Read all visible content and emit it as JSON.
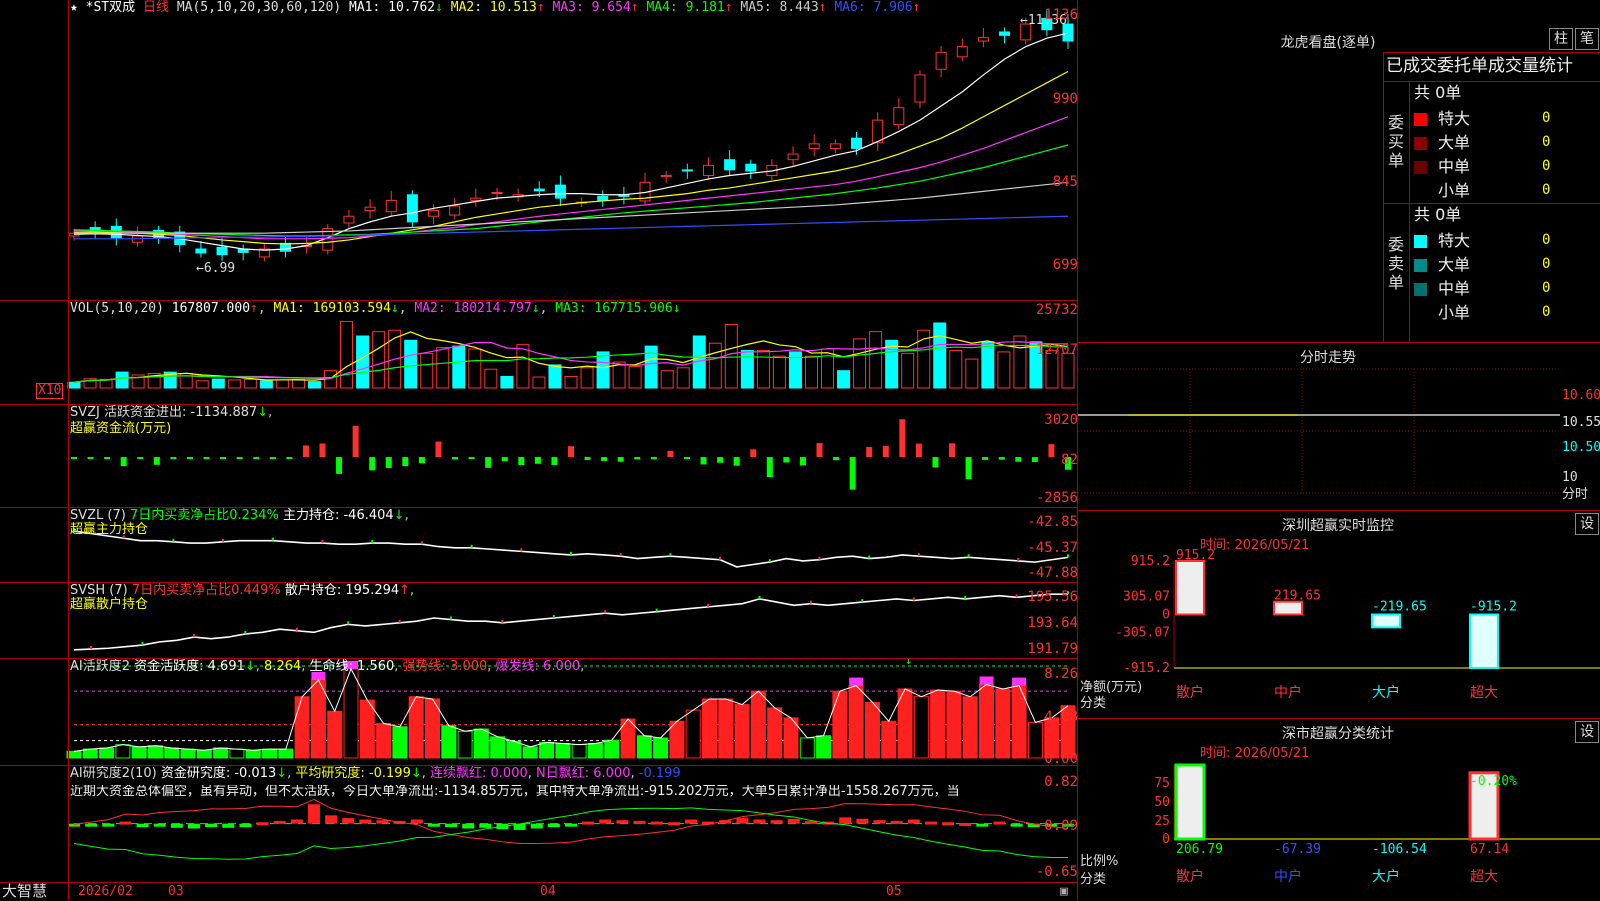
{
  "header": {
    "stock_name": "*ST双成",
    "period": "日线",
    "ma_label": "MA(5,10,20,30,60,120)",
    "ma": [
      {
        "label": "MA1: 10.762",
        "arrow": "↓",
        "color": "#ffffff"
      },
      {
        "label": "MA2: 10.513",
        "arrow": "↑",
        "color": "#ffff00"
      },
      {
        "label": "MA3: 9.654",
        "arrow": "↑",
        "color": "#ff33ff"
      },
      {
        "label": "MA4: 9.181",
        "arrow": "↑",
        "color": "#00ff00"
      },
      {
        "label": "MA5: 8.443",
        "arrow": "↑",
        "color": "#cccccc"
      },
      {
        "label": "MA6: 7.906",
        "arrow": "↑",
        "color": "#3050ff"
      }
    ],
    "hi_mark": "11.36",
    "lo_mark": "6.99"
  },
  "price_axis": [
    "1136",
    "990",
    "845",
    "699"
  ],
  "vol": {
    "label": "VOL(5,10,20)",
    "value": "167807.000",
    "ma1": "MA1: 169103.594",
    "ma2": "MA2: 180214.797",
    "ma3": "MA3: 167715.906",
    "axis": [
      "25732",
      "12707"
    ],
    "unit": "X10"
  },
  "svzj": {
    "label": "SVZJ",
    "text": "活跃资金进出: -1134.887",
    "sub": "超赢资金流(万元)",
    "axis": [
      "3020",
      "82",
      "-2856"
    ]
  },
  "svzl": {
    "label": "SVZL (7)",
    "text1": "7日内买卖净占比0.234%",
    "text2": "主力持仓: -46.404",
    "sub": "超赢主力持仓",
    "axis": [
      "-42.85",
      "-45.37",
      "-47.88"
    ]
  },
  "svsh": {
    "label": "SVSH (7)",
    "text1": "7日内买卖净占比0.449%",
    "text2": "散户持仓: 195.294",
    "sub": "超赢散户持仓",
    "axis": [
      "195.56",
      "193.64",
      "191.79"
    ]
  },
  "ai1": {
    "label": "AI活跃度2",
    "t1": "资金活跃度: 4.691",
    "t2": "8.264",
    "t3": "生命线: 1.560",
    "t4": "强势线: 3.000",
    "t5": "爆发线: 6.000",
    "axis": [
      "8.26",
      "4.08",
      "0.00"
    ]
  },
  "ai2": {
    "label": "AI研究度2(10)",
    "t1": "资金研究度: -0.013",
    "t2": "平均研究度: -0.199",
    "t3": "连续飘红: 0.000",
    "t4": "N日飘红: 6.000",
    "t5": "-0.199",
    "desc": "近期大资金总体偏空，虽有异动，但不太活跃，今日大单净流出:-1134.85万元，其中特大单净流出:-915.202万元，大单5日累计净出-1558.267万元，当",
    "axis": [
      "0.82",
      "0.09",
      "-0.65"
    ]
  },
  "bottom_axis": {
    "brand": "大智慧",
    "labels": [
      "2026/02",
      "03",
      "04",
      "05"
    ]
  },
  "lhk": {
    "title": "龙虎看盘(逐单)",
    "btn1": "柱",
    "btn2": "笔",
    "subtitle": "已成交委托单成交量统计",
    "buy": {
      "side": "委买单",
      "total": "共 0单",
      "rows": [
        {
          "name": "特大",
          "value": "0",
          "color": "#ff0000"
        },
        {
          "name": "大单",
          "value": "0",
          "color": "#8b0000"
        },
        {
          "name": "中单",
          "value": "0",
          "color": "#6b0000"
        },
        {
          "name": "小单",
          "value": "0",
          "color": "#000000"
        }
      ]
    },
    "sell": {
      "side": "委卖单",
      "total": "共 0单",
      "rows": [
        {
          "name": "特大",
          "value": "0",
          "color": "#00ffff"
        },
        {
          "name": "大单",
          "value": "0",
          "color": "#008b8b"
        },
        {
          "name": "中单",
          "value": "0",
          "color": "#007070"
        },
        {
          "name": "小单",
          "value": "0",
          "color": "#000000"
        }
      ]
    }
  },
  "fenshi": {
    "title": "分时走势",
    "axis": [
      "10.60",
      "10.55",
      "10.50",
      "10"
    ],
    "unit": "分时"
  },
  "szcy": {
    "title": "深圳超赢实时监控",
    "btn": "设",
    "time": "时间: 2026/05/21",
    "axis": [
      "915.2",
      "305.07",
      "0",
      "-305.07",
      "-915.2"
    ],
    "ylabel": "净额(万元)",
    "xlabel": "分类",
    "cats": [
      "散户",
      "中户",
      "大户",
      "超大"
    ],
    "values": [
      915.2,
      219.65,
      -219.65,
      -915.2
    ],
    "value_labels": [
      "915.2",
      "219.65",
      "-219.65",
      "-915.2"
    ]
  },
  "sscy": {
    "title": "深市超赢分类统计",
    "btn": "设",
    "time": "时间: 2026/05/21",
    "axis": [
      "75",
      "50",
      "25",
      "0"
    ],
    "ylabel": "比例%",
    "xlabel": "分类",
    "cats": [
      "散户",
      "中户",
      "大户",
      "超大"
    ],
    "bottom_values": [
      "206.79",
      "-67.39",
      "-106.54",
      "67.14"
    ],
    "top_label": "-0.20%"
  },
  "chart_data": [
    {
      "type": "candlestick",
      "title": "*ST双成 日线",
      "ylim": [
        699,
        1136
      ],
      "x": [
        "2026/02",
        "03",
        "04",
        "05"
      ],
      "series": [
        {
          "name": "close",
          "values": [
            750,
            752,
            742,
            745,
            742,
            730,
            715,
            712,
            716,
            722,
            718,
            728,
            758,
            780,
            796,
            808,
            770,
            790,
            798,
            812,
            822,
            818,
            825,
            812,
            805,
            808,
            815,
            840,
            852,
            860,
            870,
            862,
            860,
            870,
            890,
            908,
            908,
            900,
            950,
            972,
            1030,
            1070,
            1080,
            1096,
            1100,
            1120,
            1110,
            1090
          ]
        },
        {
          "name": "MA1",
          "values": [
            748,
            749,
            748,
            746,
            744,
            740,
            734,
            728,
            722,
            720,
            722,
            728,
            742,
            758,
            770,
            780,
            786,
            794,
            800,
            806,
            812,
            815,
            818,
            820,
            820,
            818,
            818,
            822,
            830,
            838,
            846,
            852,
            856,
            860,
            868,
            878,
            888,
            896,
            912,
            930,
            950,
            975,
            1000,
            1030,
            1058,
            1080,
            1095,
            1104
          ]
        },
        {
          "name": "MA2",
          "values": [
            752,
            752,
            751,
            750,
            748,
            746,
            742,
            738,
            735,
            732,
            731,
            732,
            734,
            738,
            744,
            750,
            756,
            762,
            770,
            778,
            784,
            790,
            796,
            800,
            804,
            807,
            810,
            812,
            816,
            820,
            826,
            830,
            836,
            842,
            848,
            854,
            860,
            868,
            878,
            890,
            904,
            918,
            936,
            956,
            976,
            996,
            1016,
            1036
          ]
        },
        {
          "name": "MA3",
          "values": [
            755,
            754,
            753,
            752,
            750,
            748,
            746,
            744,
            742,
            740,
            740,
            740,
            741,
            742,
            745,
            748,
            752,
            756,
            760,
            765,
            770,
            775,
            780,
            784,
            788,
            792,
            796,
            800,
            804,
            808,
            812,
            816,
            820,
            824,
            828,
            832,
            836,
            842,
            850,
            858,
            866,
            876,
            888,
            900,
            914,
            928,
            942,
            956
          ]
        },
        {
          "name": "MA4",
          "values": [
            756,
            755,
            754,
            753,
            752,
            750,
            749,
            748,
            747,
            746,
            745,
            745,
            746,
            747,
            748,
            750,
            752,
            754,
            756,
            758,
            762,
            766,
            770,
            774,
            778,
            782,
            786,
            789,
            792,
            795,
            798,
            801,
            804,
            808,
            812,
            816,
            820,
            825,
            830,
            836,
            842,
            850,
            858,
            866,
            876,
            886,
            896,
            906
          ]
        },
        {
          "name": "MA5",
          "values": [
            750,
            750,
            750,
            750,
            750,
            750,
            750,
            750,
            750,
            750,
            751,
            752,
            753,
            754,
            756,
            758,
            760,
            762,
            764,
            766,
            768,
            770,
            772,
            774,
            776,
            778,
            780,
            782,
            784,
            786,
            788,
            790,
            792,
            794,
            796,
            798,
            800,
            803,
            806,
            809,
            812,
            816,
            820,
            824,
            828,
            832,
            836,
            840
          ]
        },
        {
          "name": "MA6",
          "values": [
            740,
            740,
            740,
            740,
            741,
            741,
            742,
            742,
            743,
            743,
            744,
            744,
            745,
            746,
            747,
            748,
            749,
            750,
            751,
            752,
            753,
            754,
            755,
            756,
            757,
            758,
            759,
            760,
            761,
            762,
            763,
            764,
            765,
            766,
            767,
            768,
            769,
            770,
            771,
            772,
            773,
            774,
            775,
            776,
            777,
            778,
            779,
            780
          ]
        }
      ]
    },
    {
      "type": "bar",
      "title": "VOL(5,10,20)",
      "ylim": [
        0,
        27000
      ],
      "series": [
        {
          "name": "VOL",
          "values": [
            2000,
            3200,
            3000,
            5500,
            4500,
            5000,
            5500,
            5000,
            2500,
            3100,
            2800,
            3000,
            2500,
            2800,
            3000,
            2200,
            6000,
            23000,
            18000,
            19500,
            20000,
            16500,
            12000,
            14000,
            14500,
            13500,
            6500,
            4000,
            15000,
            3800,
            8000,
            4000,
            7000,
            12500,
            9000,
            7500,
            14500,
            6000,
            7000,
            18000,
            15500,
            22000,
            13000,
            13000,
            11000,
            12500,
            11000,
            13500,
            6000,
            17000,
            19500,
            16500,
            12000,
            20000,
            22500,
            13000,
            10000,
            16000,
            12500,
            18000,
            16000,
            13000,
            12000
          ]
        }
      ]
    },
    {
      "type": "bar",
      "title": "SVZJ 超赢资金流(万元)",
      "ylim": [
        -2856,
        3020
      ],
      "series": [
        {
          "name": "SVZJ",
          "values": [
            -40,
            -60,
            -80,
            -700,
            -80,
            -600,
            -70,
            -60,
            -60,
            -90,
            -40,
            -30,
            -20,
            -10,
            900,
            1050,
            -1300,
            2420,
            -1030,
            -840,
            -700,
            -480,
            1200,
            -180,
            -90,
            -830,
            -320,
            -620,
            -520,
            -610,
            840,
            -220,
            -300,
            -360,
            -180,
            -170,
            480,
            -70,
            -570,
            -440,
            -660,
            600,
            -1550,
            -420,
            -640,
            1080,
            -240,
            -2520,
            780,
            860,
            2920,
            1040,
            -800,
            1060,
            -1710,
            -220,
            -200,
            -360,
            -380,
            1000,
            -980
          ]
        }
      ]
    },
    {
      "type": "line",
      "title": "SVZL 超赢主力持仓",
      "ylim": [
        -47.88,
        -42.85
      ],
      "series": [
        {
          "name": "主力持仓",
          "values": [
            -44.2,
            -44.4,
            -44.6,
            -44.8,
            -45.0,
            -45.0,
            -45.1,
            -45.2,
            -45.2,
            -45.1,
            -45.0,
            -45.0,
            -45.0,
            -45.1,
            -45.2,
            -45.2,
            -45.3,
            -45.3,
            -45.2,
            -45.2,
            -45.3,
            -45.3,
            -45.5,
            -45.6,
            -45.6,
            -45.7,
            -45.8,
            -45.9,
            -46.0,
            -46.1,
            -46.2,
            -46.1,
            -46.2,
            -46.3,
            -46.5,
            -46.4,
            -46.3,
            -46.4,
            -46.5,
            -46.6,
            -47.2,
            -47.0,
            -46.8,
            -46.5,
            -46.7,
            -46.6,
            -46.4,
            -46.3,
            -46.5,
            -46.4,
            -46.2,
            -46.3,
            -46.4,
            -46.5,
            -46.4,
            -46.5,
            -46.6,
            -46.7,
            -46.8,
            -46.6,
            -46.404
          ]
        }
      ]
    },
    {
      "type": "line",
      "title": "SVSH 超赢散户持仓",
      "ylim": [
        191.79,
        195.56
      ],
      "series": [
        {
          "name": "散户持仓",
          "values": [
            191.8,
            191.85,
            191.9,
            192.0,
            192.1,
            192.3,
            192.4,
            192.6,
            192.5,
            192.6,
            192.8,
            192.9,
            193.1,
            193.0,
            192.9,
            193.2,
            193.4,
            193.3,
            193.4,
            193.5,
            193.6,
            193.8,
            193.7,
            193.6,
            193.6,
            193.5,
            193.6,
            193.7,
            193.8,
            193.9,
            194.0,
            194.1,
            194.0,
            194.1,
            194.2,
            194.3,
            194.4,
            194.5,
            194.6,
            194.7,
            195.0,
            194.8,
            194.6,
            194.7,
            194.6,
            194.7,
            194.8,
            194.9,
            195.0,
            194.9,
            195.0,
            195.1,
            195.0,
            195.1,
            195.2,
            195.1,
            195.2,
            195.3,
            195.294
          ]
        }
      ]
    },
    {
      "type": "bar",
      "title": "AI活跃度2",
      "ylim": [
        0,
        8.26
      ],
      "series": [
        {
          "name": "资金活跃度",
          "values": [
            0.6,
            0.8,
            0.9,
            1.2,
            1.0,
            1.1,
            0.9,
            0.8,
            0.7,
            0.9,
            0.8,
            0.7,
            0.8,
            0.8,
            5.5,
            7.0,
            4.2,
            8.0,
            5.2,
            3.1,
            2.8,
            5.5,
            5.3,
            2.9,
            2.4,
            2.6,
            1.9,
            1.5,
            1.0,
            1.4,
            1.3,
            1.2,
            1.3,
            1.6,
            3.5,
            2.0,
            1.8,
            3.3,
            4.3,
            5.3,
            5.3,
            4.8,
            6.0,
            4.5,
            3.6,
            1.8,
            2.0,
            6.0,
            6.5,
            5.0,
            3.3,
            6.2,
            5.5,
            6.1,
            6.0,
            5.5,
            6.6,
            6.2,
            6.5,
            3.2,
            3.6,
            4.691
          ]
        }
      ]
    },
    {
      "type": "bar",
      "title": "AI研究度2(10)",
      "ylim": [
        -0.65,
        0.82
      ],
      "series": [
        {
          "name": "资金研究度",
          "values": [
            -0.02,
            -0.03,
            -0.04,
            0.03,
            -0.05,
            -0.04,
            -0.06,
            -0.07,
            -0.05,
            -0.06,
            -0.05,
            0.02,
            0.04,
            0.06,
            0.28,
            0.12,
            0.08,
            0.06,
            0.05,
            0.04,
            0.06,
            -0.04,
            -0.05,
            -0.07,
            -0.06,
            -0.08,
            -0.09,
            -0.07,
            -0.05,
            -0.03,
            0.03,
            0.06,
            0.05,
            0.04,
            0.03,
            0.02,
            0.06,
            0.03,
            0.05,
            0.08,
            0.06,
            0.05,
            0.07,
            0.04,
            0.03,
            0.09,
            0.07,
            0.05,
            0.04,
            0.06,
            0.03,
            0.02,
            0.01,
            -0.02,
            0.03,
            -0.03,
            -0.05,
            -0.04,
            -0.013
          ]
        }
      ]
    },
    {
      "type": "bar",
      "title": "深圳超赢实时监控",
      "ylabel": "净额(万元)",
      "ylim": [
        -915.2,
        915.2
      ],
      "categories": [
        "散户",
        "中户",
        "大户",
        "超大"
      ],
      "values": [
        915.2,
        219.65,
        -219.65,
        -915.2
      ]
    },
    {
      "type": "bar",
      "title": "深市超赢分类统计",
      "ylabel": "比例%",
      "ylim": [
        0,
        75
      ],
      "categories": [
        "散户",
        "中户",
        "大户",
        "超大"
      ],
      "values": [
        206.79,
        -67.39,
        -106.54,
        67.14
      ]
    }
  ]
}
